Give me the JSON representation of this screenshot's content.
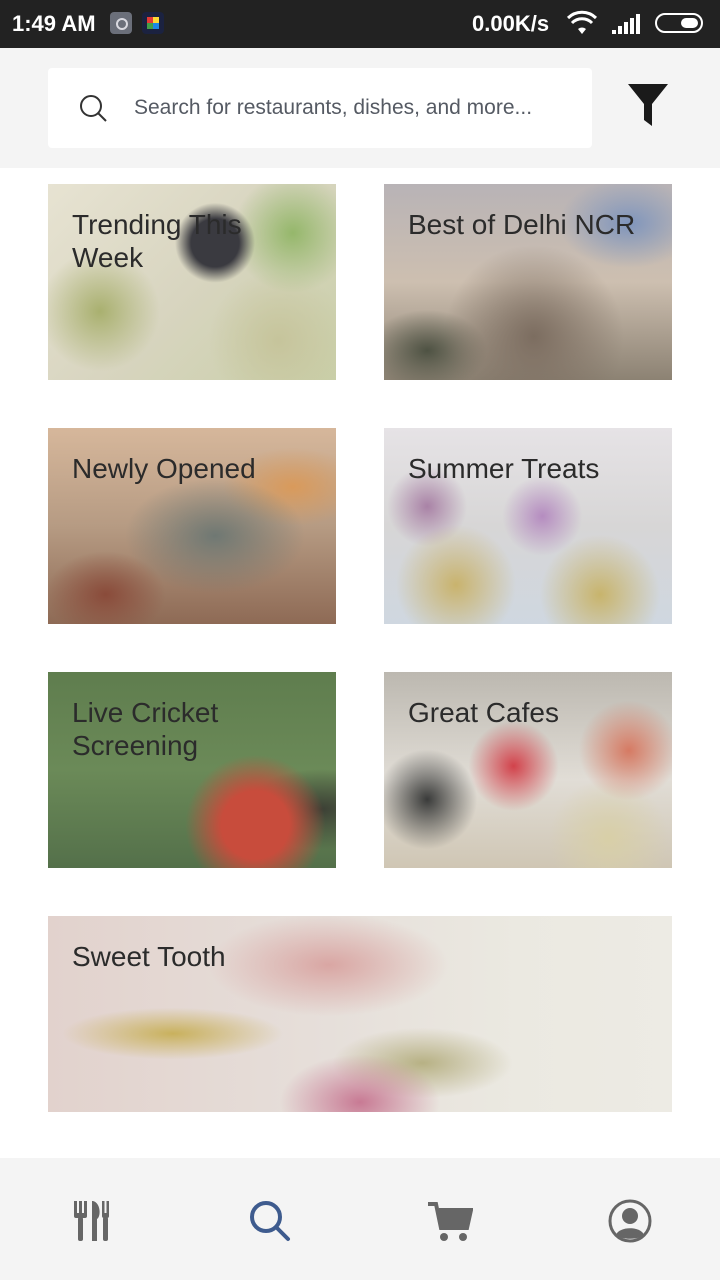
{
  "status_bar": {
    "time": "1:49 AM",
    "network_speed": "0.00K/s",
    "icons": [
      "app-icon",
      "colorful-app-icon",
      "wifi-icon",
      "signal-icon",
      "battery-icon"
    ]
  },
  "search": {
    "placeholder": "Search for restaurants, dishes, and more...",
    "value": "",
    "icon": "search-icon",
    "filter_icon": "filter-icon"
  },
  "collections": [
    {
      "title": "Trending This Week"
    },
    {
      "title": "Best of Delhi NCR"
    },
    {
      "title": "Newly Opened"
    },
    {
      "title": "Summer Treats"
    },
    {
      "title": "Live Cricket Screening"
    },
    {
      "title": "Great Cafes"
    },
    {
      "title": "Sweet Tooth"
    }
  ],
  "bottom_nav": {
    "items": [
      {
        "icon": "fork-knife-icon",
        "active": false
      },
      {
        "icon": "search-icon",
        "active": true
      },
      {
        "icon": "cart-icon",
        "active": false
      },
      {
        "icon": "profile-icon",
        "active": false
      }
    ],
    "colors": {
      "active": "#3e5b8e",
      "inactive": "#666666"
    }
  }
}
